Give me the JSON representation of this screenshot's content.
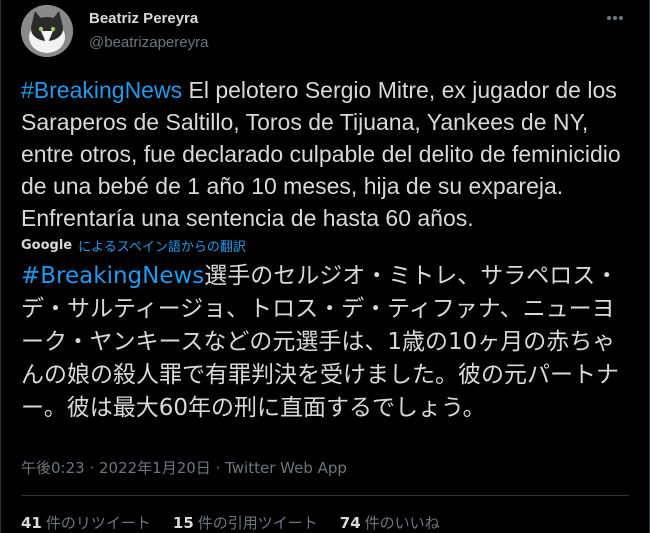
{
  "author": {
    "name": "Beatriz Pereyra",
    "handle": "@beatrizapereyra"
  },
  "tweet": {
    "hashtag": "#BreakingNews",
    "text": " El pelotero Sergio Mitre, ex jugador de los Saraperos de Saltillo, Toros de Tijuana, Yankees de NY, entre otros, fue declarado culpable del delito de feminicidio de una bebé de 1 año 10 meses, hija de su expareja. Enfrentaría una sentencia de hasta 60 años.",
    "translation_provider": "Google",
    "translation_label": "によるスペイン語からの翻訳",
    "translated_hashtag": "#BreakingNews",
    "translated_text": "選手のセルジオ・ミトレ、サラペロス・デ・サルティージョ、トロス・デ・ティファナ、ニューヨーク・ヤンキースなどの元選手は、1歳の10ヶ月の赤ちゃんの娘の殺人罪で有罪判決を受けました。彼の元パートナー。彼は最大60年の刑に直面するでしょう。",
    "timestamp": "午後0:23 · 2022年1月20日 · Twitter Web App"
  },
  "stats": {
    "retweets_count": "41",
    "retweets_label": "件のリツイート",
    "quotes_count": "15",
    "quotes_label": "件の引用ツイート",
    "likes_count": "74",
    "likes_label": "件のいいね"
  },
  "icons": {
    "more": "more-options-icon",
    "google": "google-logo"
  },
  "colors": {
    "background": "#000000",
    "text": "#d9d9d9",
    "secondary": "#6e767d",
    "link": "#1d9bf0"
  }
}
